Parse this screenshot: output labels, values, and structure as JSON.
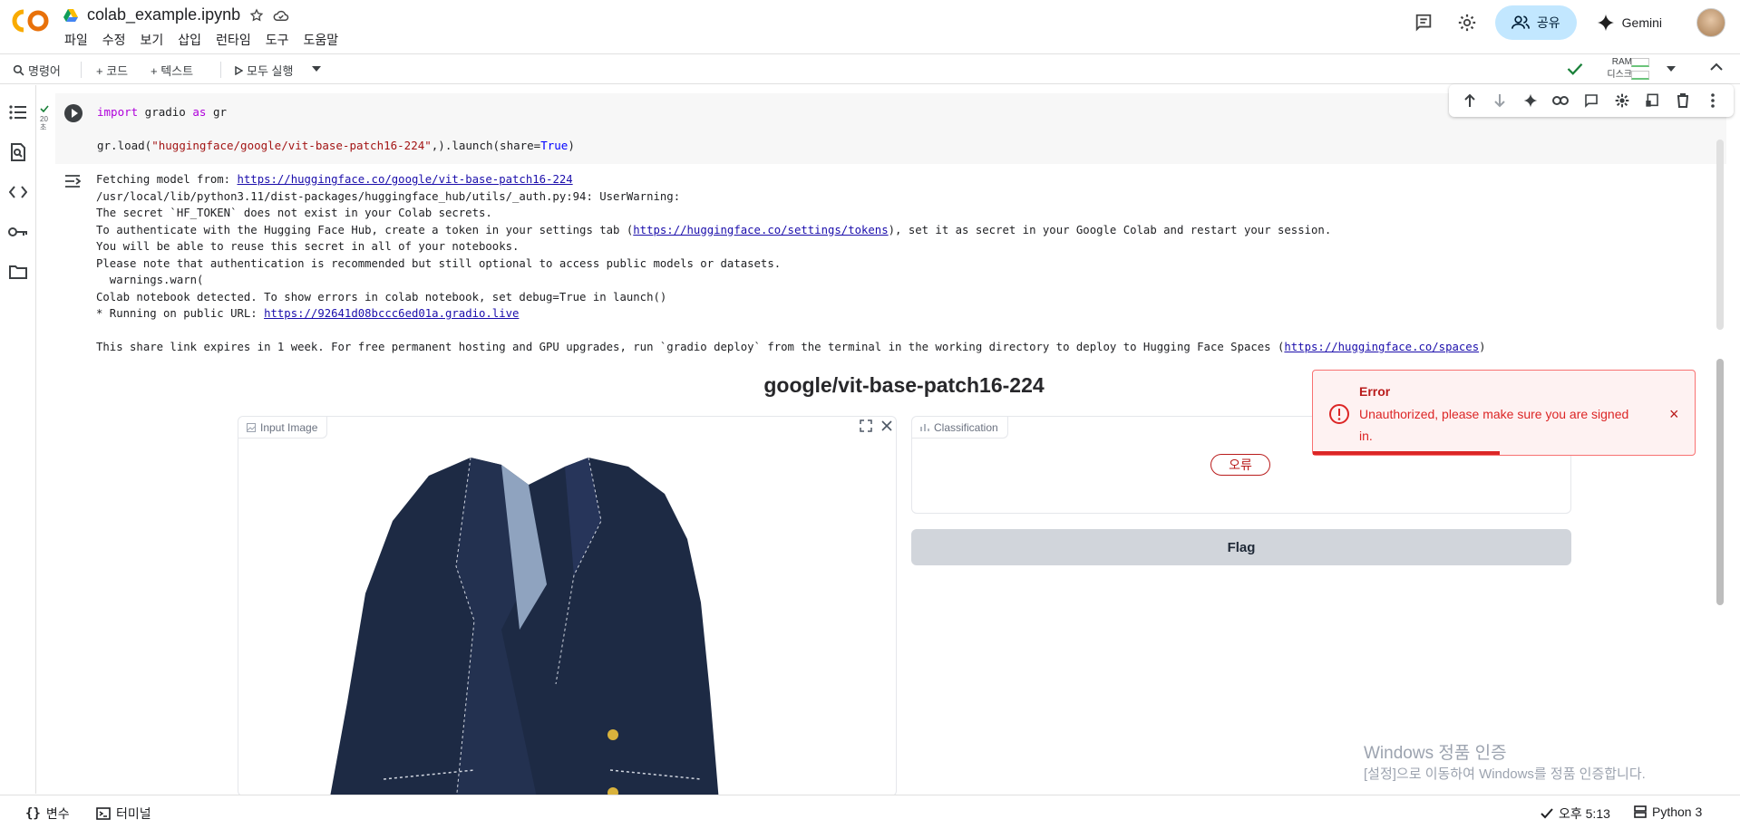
{
  "header": {
    "doc_title": "colab_example.ipynb",
    "menu": [
      "파일",
      "수정",
      "보기",
      "삽입",
      "런타임",
      "도구",
      "도움말"
    ],
    "share_label": "공유",
    "gemini_label": "Gemini"
  },
  "toolbar": {
    "commands_label": "명령어",
    "code_label": "+ 코드",
    "text_label": "+ 텍스트",
    "run_all_label": "모두 실행",
    "ram_label": "RAM",
    "disk_label": "디스크"
  },
  "cell": {
    "exec_time": "20",
    "exec_unit": "초",
    "line1_kw1": "import",
    "line1_mid": " gradio ",
    "line1_kw2": "as",
    "line1_end": " gr",
    "line2_a": "gr.load(",
    "line2_str": "\"huggingface/google/vit-base-patch16-224\"",
    "line2_b": ",).launch(share=",
    "line2_bool": "True",
    "line2_c": ")"
  },
  "output": {
    "line1_prefix": "Fetching model from: ",
    "line1_link": "https://huggingface.co/google/vit-base-patch16-224",
    "line2": "/usr/local/lib/python3.11/dist-packages/huggingface_hub/utils/_auth.py:94: UserWarning:",
    "line3": "The secret `HF_TOKEN` does not exist in your Colab secrets.",
    "line4_prefix": "To authenticate with the Hugging Face Hub, create a token in your settings tab (",
    "line4_link": "https://huggingface.co/settings/tokens",
    "line4_suffix": "), set it as secret in your Google Colab and restart your session.",
    "line5": "You will be able to reuse this secret in all of your notebooks.",
    "line6": "Please note that authentication is recommended but still optional to access public models or datasets.",
    "line7": "  warnings.warn(",
    "line8": "Colab notebook detected. To show errors in colab notebook, set debug=True in launch()",
    "line9_prefix": "* Running on public URL: ",
    "line9_link": "https://92641d08bccc6ed01a.gradio.live",
    "line10_prefix": "This share link expires in 1 week. For free permanent hosting and GPU upgrades, run `gradio deploy` from the terminal in the working directory to deploy to Hugging Face Spaces (",
    "line10_link": "https://huggingface.co/spaces",
    "line10_suffix": ")"
  },
  "gradio": {
    "title": "google/vit-base-patch16-224",
    "input_label": "Input Image",
    "output_label": "Classification",
    "error_pill": "오류",
    "flag_label": "Flag"
  },
  "toast": {
    "title": "Error",
    "message": "Unauthorized, please make sure you are signed in.",
    "close": "×",
    "progress": 0.49
  },
  "watermark": {
    "line1": "Windows 정품 인증",
    "line2": "[설정]으로 이동하여 Windows를 정품 인증합니다."
  },
  "status": {
    "vars_label": "변수",
    "terminal_label": "터미널",
    "time_label": "오후 5:13",
    "runtime_label": "Python 3"
  },
  "colors": {
    "accent": "#c2e7ff",
    "error": "#dc2626",
    "success": "#188038"
  }
}
